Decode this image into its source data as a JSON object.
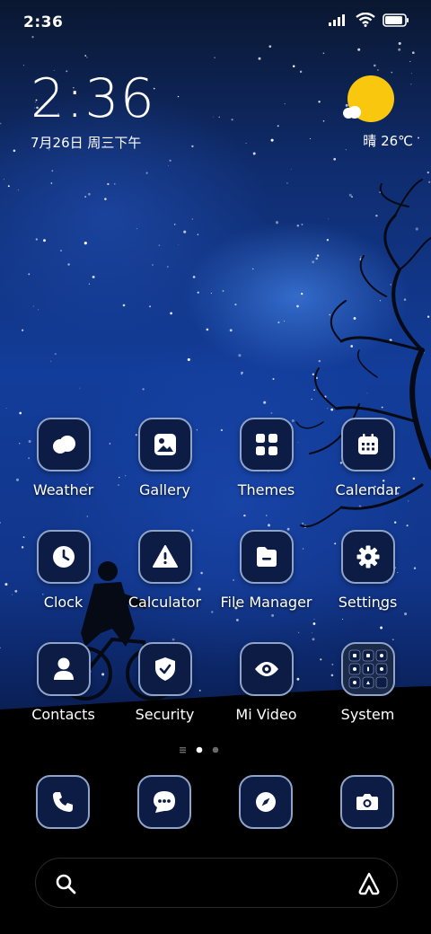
{
  "status_bar": {
    "time": "2:36",
    "battery_level": 0.9
  },
  "clock_widget": {
    "time": "2:36",
    "date": "7月26日 周三下午"
  },
  "weather_widget": {
    "condition_temp": "晴 26℃",
    "icon": "sun-cloud-icon"
  },
  "apps": [
    {
      "label": "Weather",
      "icon": "cloud-icon"
    },
    {
      "label": "Gallery",
      "icon": "image-icon"
    },
    {
      "label": "Themes",
      "icon": "grid-icon"
    },
    {
      "label": "Calendar",
      "icon": "calendar-icon"
    },
    {
      "label": "Clock",
      "icon": "clock-icon"
    },
    {
      "label": "Calculator",
      "icon": "warning-icon"
    },
    {
      "label": "File Manager",
      "icon": "folder-icon"
    },
    {
      "label": "Settings",
      "icon": "gear-icon"
    },
    {
      "label": "Contacts",
      "icon": "person-icon"
    },
    {
      "label": "Security",
      "icon": "shield-icon"
    },
    {
      "label": "Mi Video",
      "icon": "eye-icon"
    },
    {
      "label": "System",
      "icon": "folder-grid-icon"
    }
  ],
  "page_indicator": {
    "pages": 2,
    "current": 1
  },
  "dock": [
    {
      "icon": "phone-icon"
    },
    {
      "icon": "message-icon"
    },
    {
      "icon": "compass-icon"
    },
    {
      "icon": "camera-icon"
    }
  ],
  "search_bar": {
    "search_icon": "search-icon",
    "assistant_icon": "assistant-icon"
  },
  "colors": {
    "sun": "#f9c80e",
    "icon_bg": "#0c1c44",
    "icon_border": "#8fa4c9"
  }
}
